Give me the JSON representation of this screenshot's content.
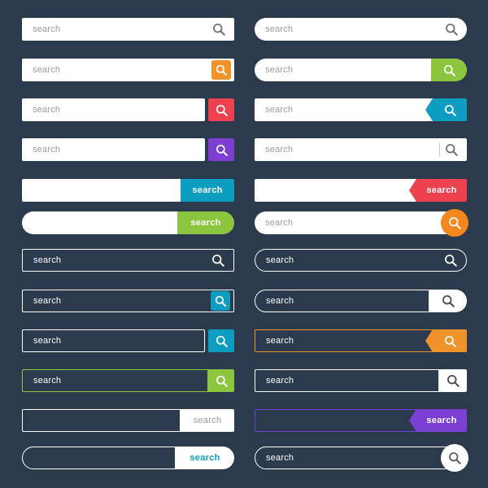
{
  "page": {
    "title": "Search bar UI kit",
    "background_color": "#2b3a4d",
    "columns": 2,
    "rows": 12,
    "total_variants": 24
  },
  "palette": {
    "background": "#2b3a4d",
    "white": "#ffffff",
    "placeholder_grey": "#9a9a9a",
    "orange": "#f0932b",
    "orange_deep": "#f4881f",
    "red": "#ef4050",
    "purple": "#7d3fd1",
    "purple_violet": "#7b3fd4",
    "green": "#8cc63e",
    "teal": "#0c9dc0",
    "outline_dim": "#8f9aa8"
  },
  "labels": {
    "placeholder": "search",
    "button_text": "search",
    "icon": "search-icon"
  },
  "variants": [
    {
      "index": 1,
      "column": "left",
      "row": 1,
      "name": "flat-white-rect-inline-grey-icon",
      "placeholder": "search",
      "placeholder_color": "#9a9a9a",
      "field_fill": "#ffffff",
      "shape": "rect",
      "action_type": "inline-icon",
      "action_color": "#6a6a6a",
      "action_label": ""
    },
    {
      "index": 2,
      "column": "right",
      "row": 1,
      "name": "flat-white-pill-inline-grey-icon",
      "placeholder": "search",
      "placeholder_color": "#9a9a9a",
      "field_fill": "#ffffff",
      "shape": "pill",
      "action_type": "inline-icon",
      "action_color": "#6a6a6a",
      "action_label": ""
    },
    {
      "index": 3,
      "column": "left",
      "row": 2,
      "name": "white-rect-orange-icon-button",
      "placeholder": "search",
      "placeholder_color": "#9a9a9a",
      "field_fill": "#ffffff",
      "shape": "rect",
      "action_type": "inset-square-button",
      "action_color": "#f0932b",
      "action_label": ""
    },
    {
      "index": 4,
      "column": "right",
      "row": 2,
      "name": "white-pill-green-icon-button",
      "placeholder": "search",
      "placeholder_color": "#9a9a9a",
      "field_fill": "#ffffff",
      "shape": "pill",
      "action_type": "pill-button",
      "action_color": "#8cc63e",
      "action_label": ""
    },
    {
      "index": 5,
      "column": "left",
      "row": 3,
      "name": "white-rect-red-detached-icon-button",
      "placeholder": "search",
      "placeholder_color": "#9a9a9a",
      "field_fill": "#ffffff",
      "shape": "rect",
      "action_type": "detached-square-button",
      "action_color": "#ef4050",
      "action_label": ""
    },
    {
      "index": 6,
      "column": "right",
      "row": 3,
      "name": "white-rect-teal-notched-icon-button",
      "placeholder": "search",
      "placeholder_color": "#9a9a9a",
      "field_fill": "#ffffff",
      "shape": "rect",
      "action_type": "notched-button",
      "action_color": "#0c9dc0",
      "action_label": ""
    },
    {
      "index": 7,
      "column": "left",
      "row": 4,
      "name": "white-rect-purple-detached-icon-button",
      "placeholder": "search",
      "placeholder_color": "#9a9a9a",
      "field_fill": "#ffffff",
      "shape": "rect",
      "action_type": "detached-square-button",
      "action_color": "#7d3fd1",
      "action_label": ""
    },
    {
      "index": 8,
      "column": "right",
      "row": 4,
      "name": "white-rect-divider-grey-icon",
      "placeholder": "search",
      "placeholder_color": "#9a9a9a",
      "field_fill": "#ffffff",
      "shape": "rect",
      "action_type": "divider-icon",
      "action_color": "#6a6a6a",
      "action_label": ""
    },
    {
      "index": 9,
      "column": "left",
      "row": 5,
      "name": "white-rect-teal-text-button",
      "placeholder": "",
      "placeholder_color": "#9a9a9a",
      "field_fill": "#ffffff",
      "shape": "rect",
      "action_type": "text-button",
      "action_color": "#0c9dc0",
      "action_label": "search"
    },
    {
      "index": 10,
      "column": "right",
      "row": 5,
      "name": "white-rect-red-notched-text-button",
      "placeholder": "",
      "placeholder_color": "#9a9a9a",
      "field_fill": "#ffffff",
      "shape": "rect",
      "action_type": "notched-text-button",
      "action_color": "#ef4050",
      "action_label": "search"
    },
    {
      "index": 11,
      "column": "left",
      "row": 6,
      "name": "white-pill-green-text-button",
      "placeholder": "",
      "placeholder_color": "#9a9a9a",
      "field_fill": "#ffffff",
      "shape": "pill",
      "action_type": "pill-text-button",
      "action_color": "#8cc63e",
      "action_label": "search"
    },
    {
      "index": 12,
      "column": "right",
      "row": 6,
      "name": "white-pill-orange-circle-icon-button",
      "placeholder": "search",
      "placeholder_color": "#9a9a9a",
      "field_fill": "#ffffff",
      "shape": "pill",
      "action_type": "circle-button",
      "action_color": "#f4881f",
      "action_label": ""
    },
    {
      "index": 13,
      "column": "left",
      "row": 7,
      "name": "outline-rect-white-inline-icon",
      "placeholder": "search",
      "placeholder_color": "#ffffff",
      "field_fill": "transparent",
      "shape": "rect",
      "action_type": "inline-icon",
      "action_color": "#ffffff",
      "action_label": ""
    },
    {
      "index": 14,
      "column": "right",
      "row": 7,
      "name": "outline-pill-white-inline-icon",
      "placeholder": "search",
      "placeholder_color": "#ffffff",
      "field_fill": "transparent",
      "shape": "pill",
      "action_type": "inline-icon",
      "action_color": "#ffffff",
      "action_label": ""
    },
    {
      "index": 15,
      "column": "left",
      "row": 8,
      "name": "outline-rect-teal-inset-icon-button",
      "placeholder": "search",
      "placeholder_color": "#ffffff",
      "field_fill": "transparent",
      "shape": "rect",
      "action_type": "inset-square-button",
      "action_color": "#0c9dc0",
      "action_label": ""
    },
    {
      "index": 16,
      "column": "right",
      "row": 8,
      "name": "outline-pill-white-inset-icon-button",
      "placeholder": "search",
      "placeholder_color": "#ffffff",
      "field_fill": "transparent",
      "shape": "pill",
      "action_type": "white-block-button",
      "action_color": "#ffffff",
      "action_label": ""
    },
    {
      "index": 17,
      "column": "left",
      "row": 9,
      "name": "outline-rect-teal-detached-icon-button",
      "placeholder": "search",
      "placeholder_color": "#ffffff",
      "field_fill": "transparent",
      "shape": "rect",
      "action_type": "detached-square-button",
      "action_color": "#0c9dc0",
      "action_label": ""
    },
    {
      "index": 18,
      "column": "right",
      "row": 9,
      "name": "orange-outline-rect-orange-notched-icon-button",
      "placeholder": "search",
      "placeholder_color": "#ffffff",
      "field_fill": "transparent",
      "shape": "rect",
      "border_color": "#f0932b",
      "action_type": "notched-button",
      "action_color": "#f0932b",
      "action_label": ""
    },
    {
      "index": 19,
      "column": "left",
      "row": 10,
      "name": "green-outline-rect-green-icon-button",
      "placeholder": "search",
      "placeholder_color": "#ffffff",
      "field_fill": "transparent",
      "shape": "rect",
      "border_color": "#8cc63e",
      "action_type": "attached-square-button",
      "action_color": "#8cc63e",
      "action_label": ""
    },
    {
      "index": 20,
      "column": "right",
      "row": 10,
      "name": "outline-rect-white-divider-icon-button",
      "placeholder": "search",
      "placeholder_color": "#ffffff",
      "field_fill": "transparent",
      "shape": "rect",
      "action_type": "white-block-button",
      "action_color": "#ffffff",
      "action_label": ""
    },
    {
      "index": 21,
      "column": "left",
      "row": 11,
      "name": "outline-rect-white-grey-text-button",
      "placeholder": "",
      "placeholder_color": "#ffffff",
      "field_fill": "transparent",
      "shape": "rect",
      "action_type": "white-text-button",
      "action_color": "#ffffff",
      "action_label": "search",
      "action_text_color": "#9a9a9a"
    },
    {
      "index": 22,
      "column": "right",
      "row": 11,
      "name": "purple-outline-rect-purple-notched-text-button",
      "placeholder": "",
      "placeholder_color": "#ffffff",
      "field_fill": "transparent",
      "shape": "rect",
      "border_color": "#7b3fd4",
      "action_type": "notched-text-button",
      "action_color": "#7b3fd4",
      "action_label": "search"
    },
    {
      "index": 23,
      "column": "left",
      "row": 12,
      "name": "outline-pill-white-teal-text-button",
      "placeholder": "",
      "placeholder_color": "#ffffff",
      "field_fill": "transparent",
      "shape": "pill",
      "action_type": "pill-white-text-button",
      "action_color": "#ffffff",
      "action_label": "search",
      "action_text_color": "#0c9dc0"
    },
    {
      "index": 24,
      "column": "right",
      "row": 12,
      "name": "outline-pill-white-circle-icon-button",
      "placeholder": "search",
      "placeholder_color": "#ffffff",
      "field_fill": "transparent",
      "shape": "pill",
      "action_type": "circle-button",
      "action_color": "#ffffff",
      "action_label": ""
    }
  ]
}
